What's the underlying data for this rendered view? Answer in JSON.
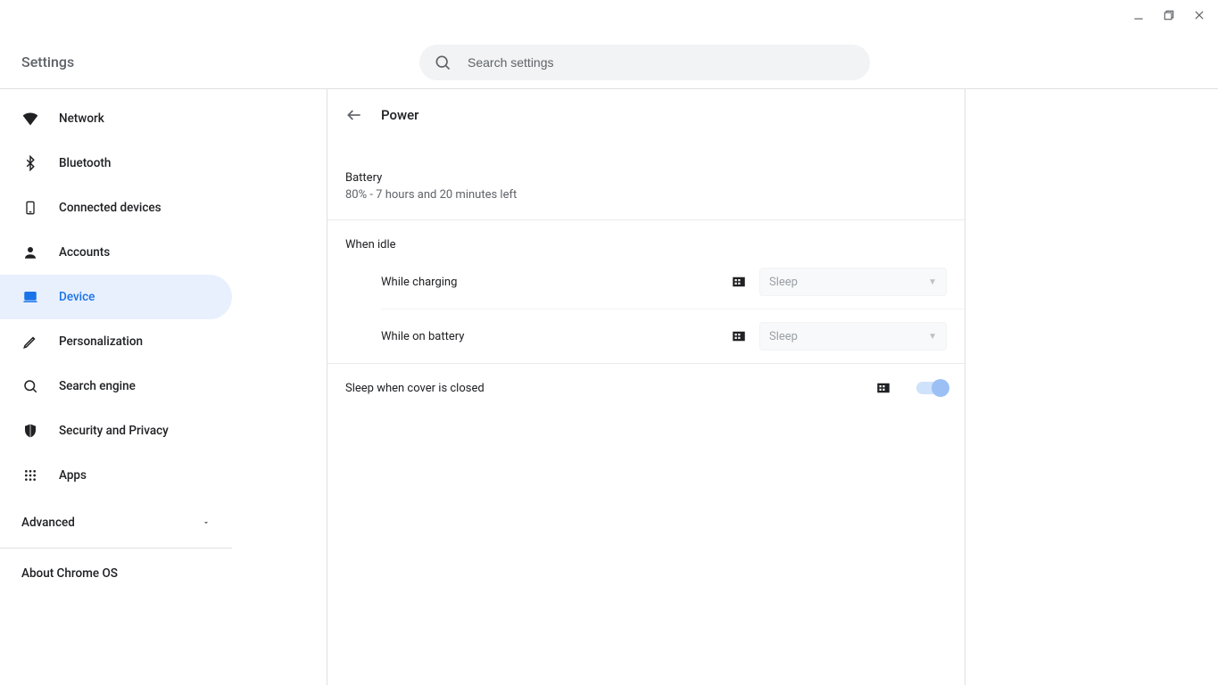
{
  "app": {
    "title": "Settings"
  },
  "search": {
    "placeholder": "Search settings"
  },
  "sidebar": {
    "items": [
      {
        "label": "Network"
      },
      {
        "label": "Bluetooth"
      },
      {
        "label": "Connected devices"
      },
      {
        "label": "Accounts"
      },
      {
        "label": "Device"
      },
      {
        "label": "Personalization"
      },
      {
        "label": "Search engine"
      },
      {
        "label": "Security and Privacy"
      },
      {
        "label": "Apps"
      }
    ],
    "advanced": "Advanced",
    "about": "About Chrome OS"
  },
  "page": {
    "title": "Power",
    "battery": {
      "label": "Battery",
      "status": "80% - 7 hours and 20 minutes left"
    },
    "idle": {
      "title": "When idle",
      "charging": {
        "label": "While charging",
        "value": "Sleep"
      },
      "battery": {
        "label": "While on battery",
        "value": "Sleep"
      }
    },
    "cover": {
      "label": "Sleep when cover is closed",
      "enabled": true
    }
  }
}
